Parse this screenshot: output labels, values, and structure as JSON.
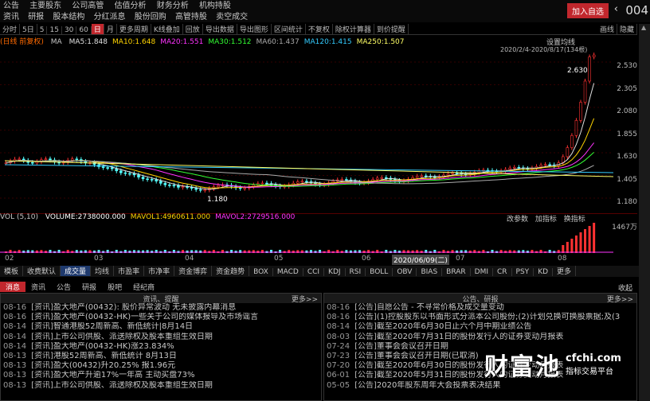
{
  "app": {
    "menu": [
      "公告",
      "主要股东",
      "公司高管",
      "估值分析",
      "财务分析",
      "机构持股"
    ],
    "submenu": [
      "资讯",
      "研报",
      "股本结构",
      "分红派息",
      "股份回购",
      "高管持股",
      "卖空成交"
    ],
    "add_watch_label": "加入自选",
    "code_label": "004"
  },
  "toolbar": {
    "items": [
      "分时",
      "5日",
      "5",
      "15",
      "30",
      "60",
      "日",
      "月",
      "更多周期",
      "K线叠加",
      "回放",
      "导出数据",
      "导出图形",
      "区间统计",
      "不复权",
      "除权计算器",
      "到价提醒"
    ],
    "selected": "日",
    "right_items": [
      "画线",
      "隐藏"
    ]
  },
  "ma_line": {
    "label": "(日线 前复权)",
    "items": [
      {
        "text": "MA5:1.848",
        "color": "#e0e0e0"
      },
      {
        "text": "MA10:1.648",
        "color": "#ffd400"
      },
      {
        "text": "MA20:1.551",
        "color": "#ff33ff"
      },
      {
        "text": "MA30:1.512",
        "color": "#33ff33"
      },
      {
        "text": "MA60:1.437",
        "color": "#aaaaaa"
      },
      {
        "text": "MA120:1.415",
        "color": "#33ccff"
      },
      {
        "text": "MA250:1.507",
        "color": "#ffff66"
      }
    ],
    "settings_label": "设置均线",
    "range_label": "2020/2/4-2020/8/17(134根)"
  },
  "price_axis": [
    "2.530",
    "2.305",
    "2.080",
    "1.855",
    "1.630",
    "1.405",
    "1.180"
  ],
  "annotations": {
    "high": "2.630",
    "low": "1.180"
  },
  "volume": {
    "label": "VOL (5,10)",
    "items": [
      {
        "text": "VOLUME:2738000.000",
        "color": "#ffffff"
      },
      {
        "text": "MAVOL1:4960611.000",
        "color": "#ffd400"
      },
      {
        "text": "MAVOL2:2729516.000",
        "color": "#ff33ff"
      }
    ],
    "axis_top": "1467万",
    "buttons": [
      "改参数",
      "加指标",
      "换指标"
    ]
  },
  "xaxis": [
    "02",
    "03",
    "04",
    "05",
    "06",
    "2020/06/09(二)",
    "07",
    "08"
  ],
  "indicator_tabs": {
    "items": [
      "模板",
      "收费默认",
      "成交量",
      "均线",
      "市盈率",
      "市净率",
      "资金博弈",
      "资金趋势",
      "BOX",
      "MACD",
      "CCI",
      "KDJ",
      "RSI",
      "BOLL",
      "OBV",
      "BIAS",
      "BRAR",
      "DMI",
      "CR",
      "PSY",
      "KD",
      "更多"
    ],
    "selected": "成交量"
  },
  "news_tabs": {
    "items": [
      "消息",
      "资讯",
      "公告",
      "研报",
      "股吧",
      "经纪商"
    ],
    "selected": "消息",
    "right": "收起"
  },
  "news_left": {
    "title": "资讯、提醒",
    "more": "更多>>",
    "items": [
      {
        "date": "08-16",
        "tag": "[资讯]",
        "text": "盈大地产(00432): 股价异常波动 无未披露内幕消息"
      },
      {
        "date": "08-16",
        "tag": "[资讯]",
        "text": "盈大地产(00432-HK)一些关于公司的媒体报导及市场谣言"
      },
      {
        "date": "08-14",
        "tag": "[资讯]",
        "text": "智通港股52周新高、新低统计|8月14日"
      },
      {
        "date": "08-14",
        "tag": "[资讯]",
        "text": "上市公司供股、派送除权及股本重组生效日期"
      },
      {
        "date": "08-14",
        "tag": "[资讯]",
        "text": "盈大地产(00432-HK)涨23.834%"
      },
      {
        "date": "08-13",
        "tag": "[资讯]",
        "text": "港股52周新高、新低统计 8月13日"
      },
      {
        "date": "08-13",
        "tag": "[资讯]",
        "text": "盈大(00432)升20.25% 报1.96元"
      },
      {
        "date": "08-13",
        "tag": "[资讯]",
        "text": "盈大地产升逾17%一年高 主动买盘73%"
      },
      {
        "date": "08-13",
        "tag": "[资讯]",
        "text": "上市公司供股、派送除权及股本重组生效日期"
      }
    ]
  },
  "news_right": {
    "title": "公告、研报",
    "more": "更多>>",
    "items": [
      {
        "date": "08-16",
        "tag": "[公告]",
        "text": "自愿公告 - 不寻常价格及成交量变动"
      },
      {
        "date": "08-16",
        "tag": "[公告]",
        "text": "(1)控股股东以书面形式分派本公司股份;(2)计划兑换可换股票据;及(3"
      },
      {
        "date": "08-14",
        "tag": "[公告]",
        "text": "截至2020年6月30日止六个月中期业绩公告"
      },
      {
        "date": "08-03",
        "tag": "[公告]",
        "text": "截至2020年7月31日的股份发行人的证券变动月报表"
      },
      {
        "date": "07-24",
        "tag": "[公告]",
        "text": "董事会会议召开日期"
      },
      {
        "date": "07-23",
        "tag": "[公告]",
        "text": "董事会会议召开日期(已取消)"
      },
      {
        "date": "07-20",
        "tag": "[公告]",
        "text": "截至2020年6月30日的股份发行人的证券变动月报表"
      },
      {
        "date": "06-01",
        "tag": "[公告]",
        "text": "截至2020年5月31日的股份发行人的证券变动月报表"
      },
      {
        "date": "05-05",
        "tag": "[公告]",
        "text": "2020年股东周年大会投票表决结果"
      }
    ]
  },
  "watermark": {
    "brand": "财富池",
    "site": "cfchi.com",
    "slogan": "指标交易平台"
  }
}
